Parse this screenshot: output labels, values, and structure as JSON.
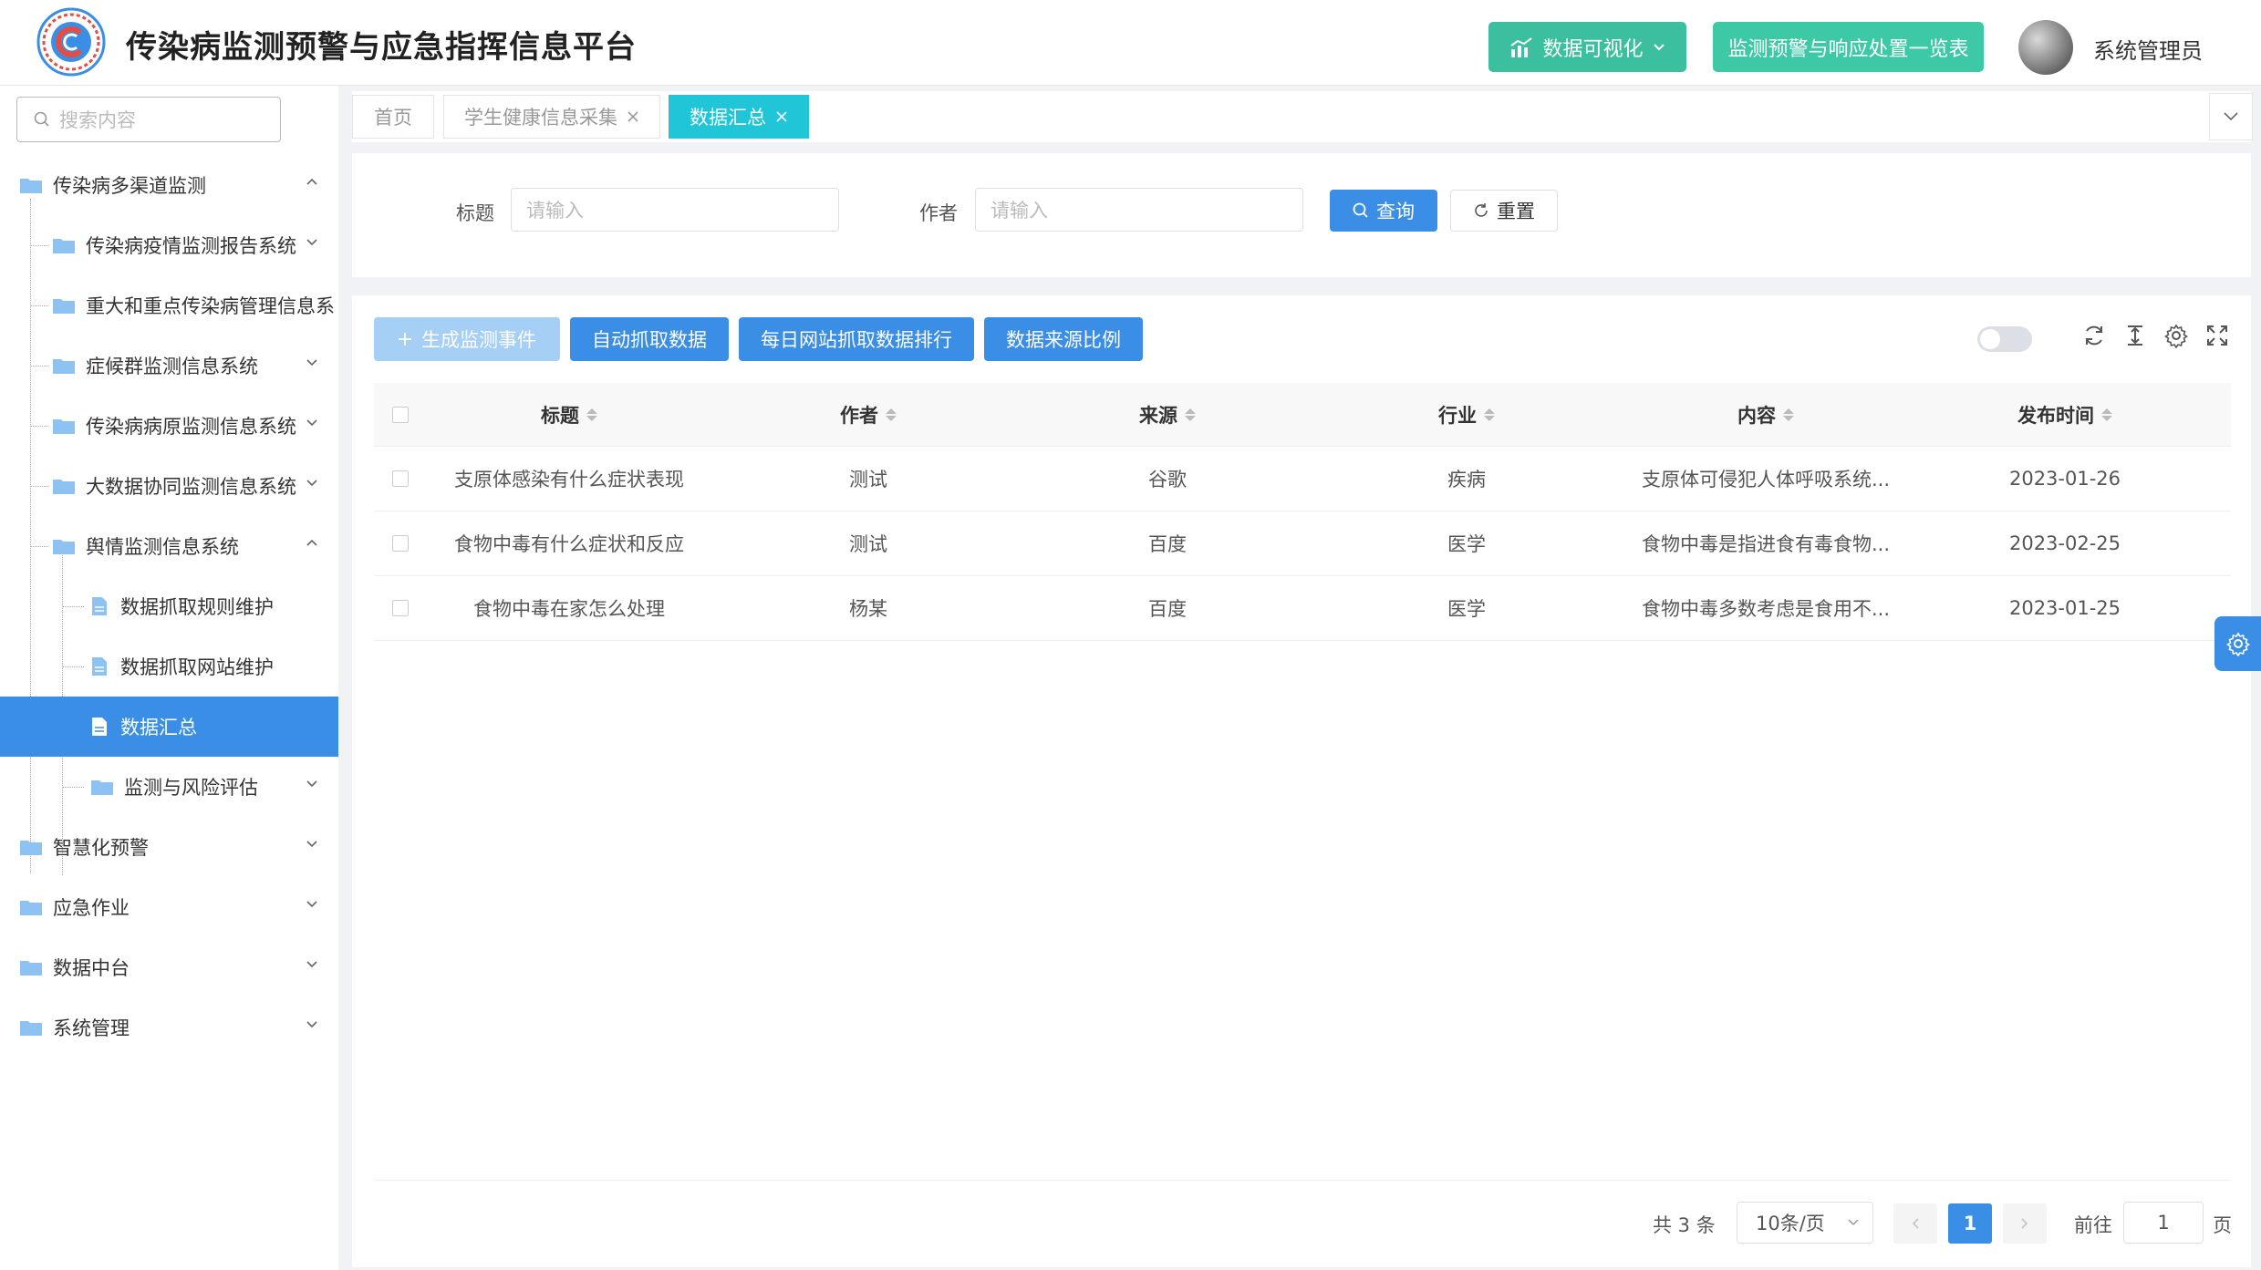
{
  "header": {
    "app_title": "传染病监测预警与应急指挥信息平台",
    "viz_button": "数据可视化",
    "warn_button": "监测预警与响应处置一览表",
    "username": "系统管理员"
  },
  "sidebar": {
    "search_placeholder": "搜索内容",
    "items": [
      {
        "label": "传染病多渠道监测",
        "level": 0,
        "expanded": true
      },
      {
        "label": "传染病疫情监测报告系统",
        "level": 1
      },
      {
        "label": "重大和重点传染病管理信息系",
        "level": 1
      },
      {
        "label": "症候群监测信息系统",
        "level": 1
      },
      {
        "label": "传染病病原监测信息系统",
        "level": 1
      },
      {
        "label": "大数据协同监测信息系统",
        "level": 1
      },
      {
        "label": "舆情监测信息系统",
        "level": 1,
        "expanded": true
      },
      {
        "label": "数据抓取规则维护",
        "level": 2
      },
      {
        "label": "数据抓取网站维护",
        "level": 2
      },
      {
        "label": "数据汇总",
        "level": 2,
        "active": true
      },
      {
        "label": "监测与风险评估",
        "level": 2
      },
      {
        "label": "智慧化预警",
        "level": 0
      },
      {
        "label": "应急作业",
        "level": 0
      },
      {
        "label": "数据中台",
        "level": 0
      },
      {
        "label": "系统管理",
        "level": 0
      }
    ]
  },
  "tabs": [
    {
      "label": "首页"
    },
    {
      "label": "学生健康信息采集"
    },
    {
      "label": "数据汇总",
      "active": true
    }
  ],
  "search": {
    "title_label": "标题",
    "title_placeholder": "请输入",
    "author_label": "作者",
    "author_placeholder": "请输入",
    "query_button": "查询",
    "reset_button": "重置"
  },
  "toolbar": {
    "generate_event": "生成监测事件",
    "auto_fetch": "自动抓取数据",
    "daily_ranking": "每日网站抓取数据排行",
    "source_ratio": "数据来源比例"
  },
  "table": {
    "columns": [
      "标题",
      "作者",
      "来源",
      "行业",
      "内容",
      "发布时间"
    ],
    "rows": [
      [
        "支原体感染有什么症状表现",
        "测试",
        "谷歌",
        "疾病",
        "支原体可侵犯人体呼吸系统...",
        "2023-01-26"
      ],
      [
        "食物中毒有什么症状和反应",
        "测试",
        "百度",
        "医学",
        "食物中毒是指进食有毒食物...",
        "2023-02-25"
      ],
      [
        "食物中毒在家怎么处理",
        "杨某",
        "百度",
        "医学",
        "食物中毒多数考虑是食用不...",
        "2023-01-25"
      ]
    ]
  },
  "pagination": {
    "total": "共 3 条",
    "page_size": "10条/页",
    "current_page": "1",
    "goto_label": "前往",
    "goto_value": "1",
    "page_suffix": "页"
  },
  "colors": {
    "primary": "#3a8ee6",
    "teal": "#3bbf9e",
    "active_tab": "#20c6d8"
  }
}
